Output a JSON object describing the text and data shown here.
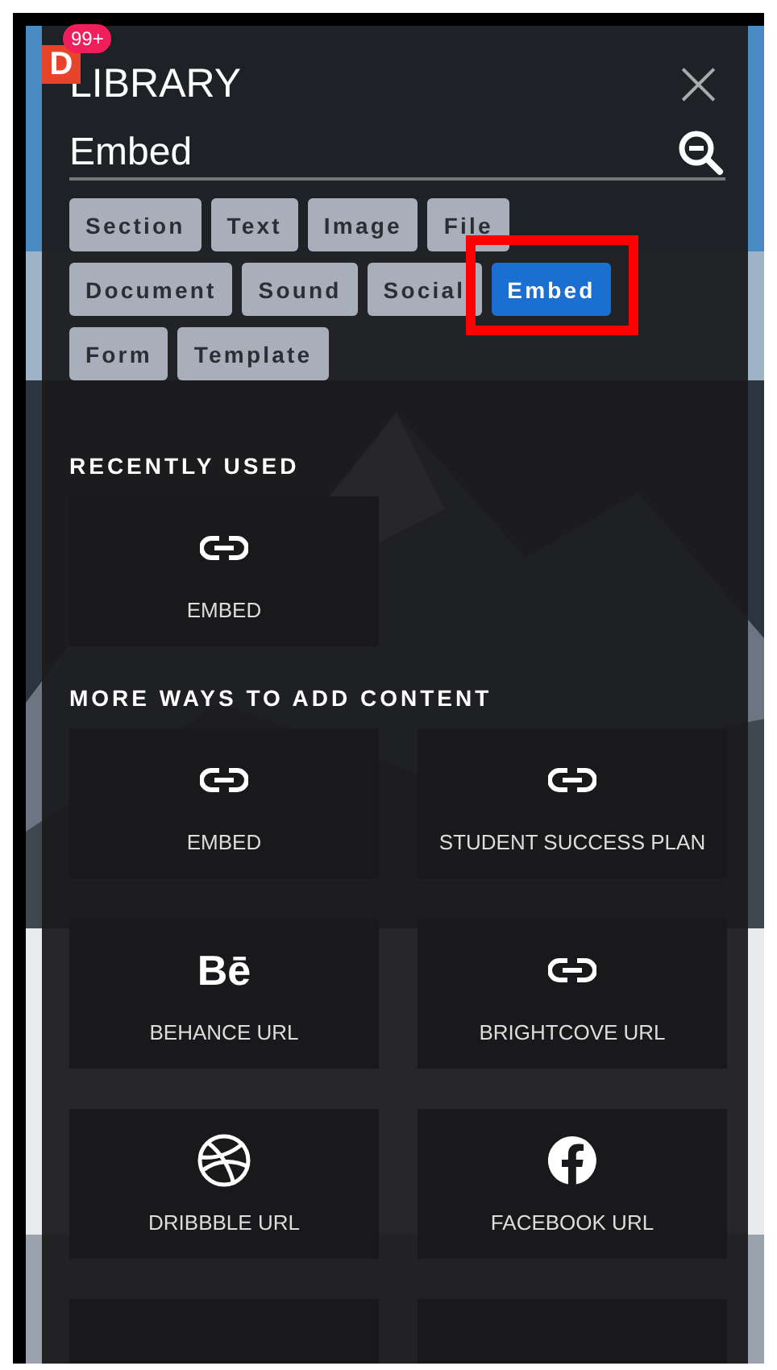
{
  "app_badge": {
    "logo": "D",
    "count": "99+"
  },
  "panel": {
    "title": "LIBRARY",
    "close": "×"
  },
  "search": {
    "value": "Embed"
  },
  "filters": [
    {
      "label": "Section",
      "selected": false,
      "highlighted": false
    },
    {
      "label": "Text",
      "selected": false,
      "highlighted": false
    },
    {
      "label": "Image",
      "selected": false,
      "highlighted": false
    },
    {
      "label": "File",
      "selected": false,
      "highlighted": false
    },
    {
      "label": "Document",
      "selected": false,
      "highlighted": false
    },
    {
      "label": "Sound",
      "selected": false,
      "highlighted": false
    },
    {
      "label": "Social",
      "selected": false,
      "highlighted": false
    },
    {
      "label": "Embed",
      "selected": true,
      "highlighted": true
    },
    {
      "label": "Form",
      "selected": false,
      "highlighted": false
    },
    {
      "label": "Template",
      "selected": false,
      "highlighted": false
    }
  ],
  "sections": [
    {
      "heading": "RECENTLY USED",
      "items": [
        {
          "kind": "link",
          "label": "EMBED"
        }
      ]
    },
    {
      "heading": "MORE WAYS TO ADD CONTENT",
      "items": [
        {
          "kind": "link",
          "label": "EMBED"
        },
        {
          "kind": "link",
          "label": "STUDENT SUCCESS PLAN"
        },
        {
          "kind": "glyph",
          "glyph": "Bē",
          "label": "BEHANCE URL"
        },
        {
          "kind": "link",
          "label": "BRIGHTCOVE URL"
        },
        {
          "kind": "dribbble",
          "label": "DRIBBBLE URL"
        },
        {
          "kind": "facebook",
          "label": "FACEBOOK URL"
        },
        {
          "kind": "blank"
        },
        {
          "kind": "blank"
        }
      ]
    }
  ]
}
